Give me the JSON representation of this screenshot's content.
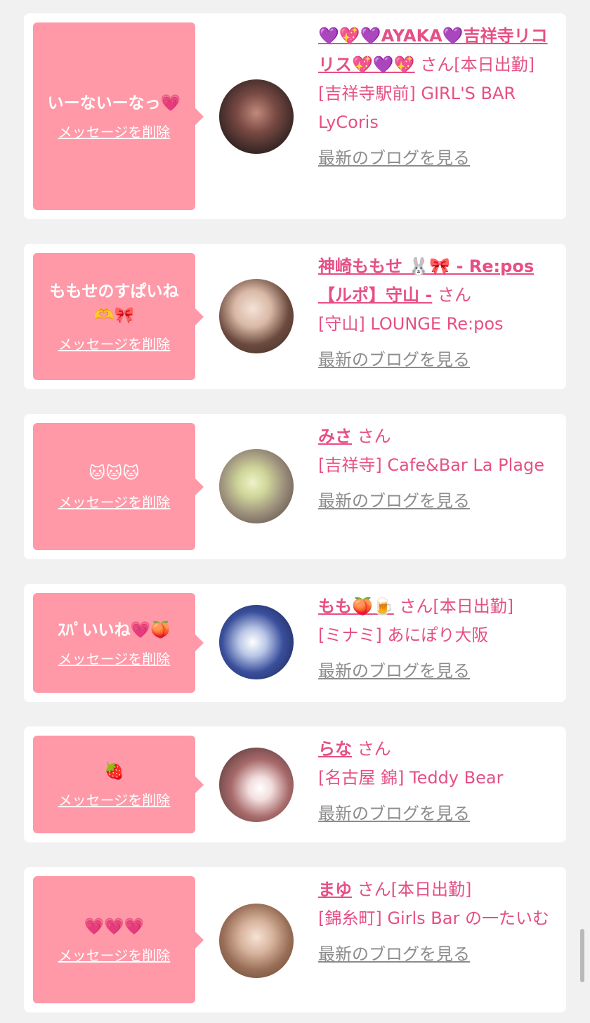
{
  "cards": [
    {
      "message": "いーないーなっ💗",
      "delete_label": "メッセージを削除",
      "name": "💜💖💜AYAKA💜吉祥寺リコリス💖💜💖",
      "san": "さん[本日出勤]",
      "shop": "[吉祥寺駅前] GIRL'S BAR LyCoris",
      "blog": "最新のブログを見る"
    },
    {
      "message": "ももせのすぱいね🫶🎀",
      "delete_label": "メッセージを削除",
      "name": "神崎ももせ 🐰🎀 - Re:pos【ルポ】守山 -",
      "san": "さん",
      "shop": "[守山] LOUNGE Re:pos",
      "blog": "最新のブログを見る"
    },
    {
      "message": "🐱🐱🐱",
      "delete_label": "メッセージを削除",
      "name": "みさ",
      "san": "さん",
      "shop": "[吉祥寺] Cafe&Bar La Plage",
      "blog": "最新のブログを見る"
    },
    {
      "message": "ｽﾊﾟいいね💗🍑",
      "delete_label": "メッセージを削除",
      "name": "もも🍑🍺",
      "san": "さん[本日出勤]",
      "shop": "[ミナミ] あにぽり大阪",
      "blog": "最新のブログを見る"
    },
    {
      "message": "🍓",
      "delete_label": "メッセージを削除",
      "name": "らな",
      "san": "さん",
      "shop": "[名古屋 錦] Teddy Bear",
      "blog": "最新のブログを見る"
    },
    {
      "message": "💗💗💗",
      "delete_label": "メッセージを削除",
      "name": "まゆ",
      "san": "さん[本日出勤]",
      "shop": "[錦糸町] Girls Bar の一たいむ",
      "blog": "最新のブログを見る"
    }
  ]
}
